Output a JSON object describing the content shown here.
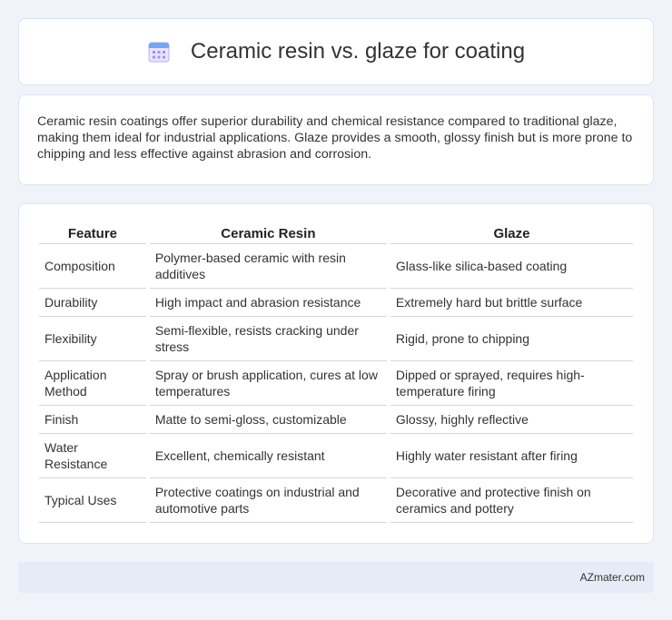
{
  "header": {
    "title": "Ceramic resin vs. glaze for coating",
    "icon": "calendar-grid-icon"
  },
  "summary": {
    "text": "Ceramic resin coatings offer superior durability and chemical resistance compared to traditional glaze, making them ideal for industrial applications. Glaze provides a smooth, glossy finish but is more prone to chipping and less effective against abrasion and corrosion."
  },
  "table": {
    "headers": [
      "Feature",
      "Ceramic Resin",
      "Glaze"
    ],
    "rows": [
      {
        "feature": "Composition",
        "resin": "Polymer-based ceramic with resin additives",
        "glaze": "Glass-like silica-based coating"
      },
      {
        "feature": "Durability",
        "resin": "High impact and abrasion resistance",
        "glaze": "Extremely hard but brittle surface"
      },
      {
        "feature": "Flexibility",
        "resin": "Semi-flexible, resists cracking under stress",
        "glaze": "Rigid, prone to chipping"
      },
      {
        "feature": "Application Method",
        "resin": "Spray or brush application, cures at low temperatures",
        "glaze": "Dipped or sprayed, requires high-temperature firing"
      },
      {
        "feature": "Finish",
        "resin": "Matte to semi-gloss, customizable",
        "glaze": "Glossy, highly reflective"
      },
      {
        "feature": "Water Resistance",
        "resin": "Excellent, chemically resistant",
        "glaze": "Highly water resistant after firing"
      },
      {
        "feature": "Typical Uses",
        "resin": "Protective coatings on industrial and automotive parts",
        "glaze": "Decorative and protective finish on ceramics and pottery"
      }
    ]
  },
  "footer": {
    "brand": "AZmater.com"
  }
}
